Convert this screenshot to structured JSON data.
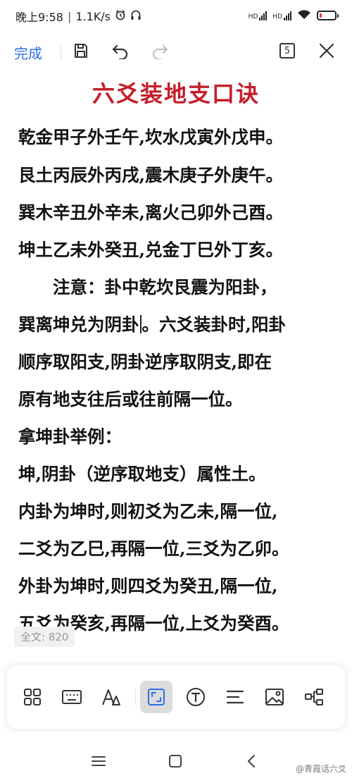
{
  "status": {
    "time": "晚上9:58",
    "speed": "1.1K/s",
    "separator": "|",
    "hd1": "HD",
    "hd2": "HD",
    "battery_level": 0.15
  },
  "toolbar": {
    "done_label": "完成",
    "page_count": "5",
    "icons": [
      "save-icon",
      "undo-icon",
      "redo-icon",
      "page-count-icon",
      "close-icon"
    ]
  },
  "document": {
    "title": "六爻装地支口诀",
    "lines": [
      "乾金甲子外壬午,坎水戊寅外戊申。",
      "艮土丙辰外丙戌,震木庚子外庚午。",
      "巽木辛丑外辛未,离火己卯外己酉。",
      "坤土乙未外癸丑,兑金丁巳外丁亥。",
      "　　注意：卦中乾坎艮震为阳卦，",
      "巽离坤兑为阴卦",
      "。六爻装卦时,阳卦",
      "顺序取阳支,阴卦逆序取阴支,即在",
      "原有地支往后或往前隔一位。",
      "拿坤卦举例：",
      "坤,阴卦（逆序取地支）属性土。",
      "内卦为坤时,则初爻为乙未,隔一位,",
      "二爻为乙巳,再隔一位,三爻为乙卯。",
      "外卦为坤时,则四爻为癸丑,隔一位,",
      "五爻为癸亥,再隔一位,上爻为癸酉。"
    ],
    "word_count": "全文: 820"
  },
  "editbar": {
    "icons": [
      "apps-icon",
      "keyboard-icon",
      "text-style-icon",
      "crop-icon",
      "text-icon",
      "align-icon",
      "image-icon",
      "mindmap-icon"
    ],
    "active": "crop-icon"
  },
  "nav": {
    "icons": [
      "menu-icon",
      "home-icon",
      "back-icon"
    ],
    "watermark": "@青霞话六爻"
  }
}
